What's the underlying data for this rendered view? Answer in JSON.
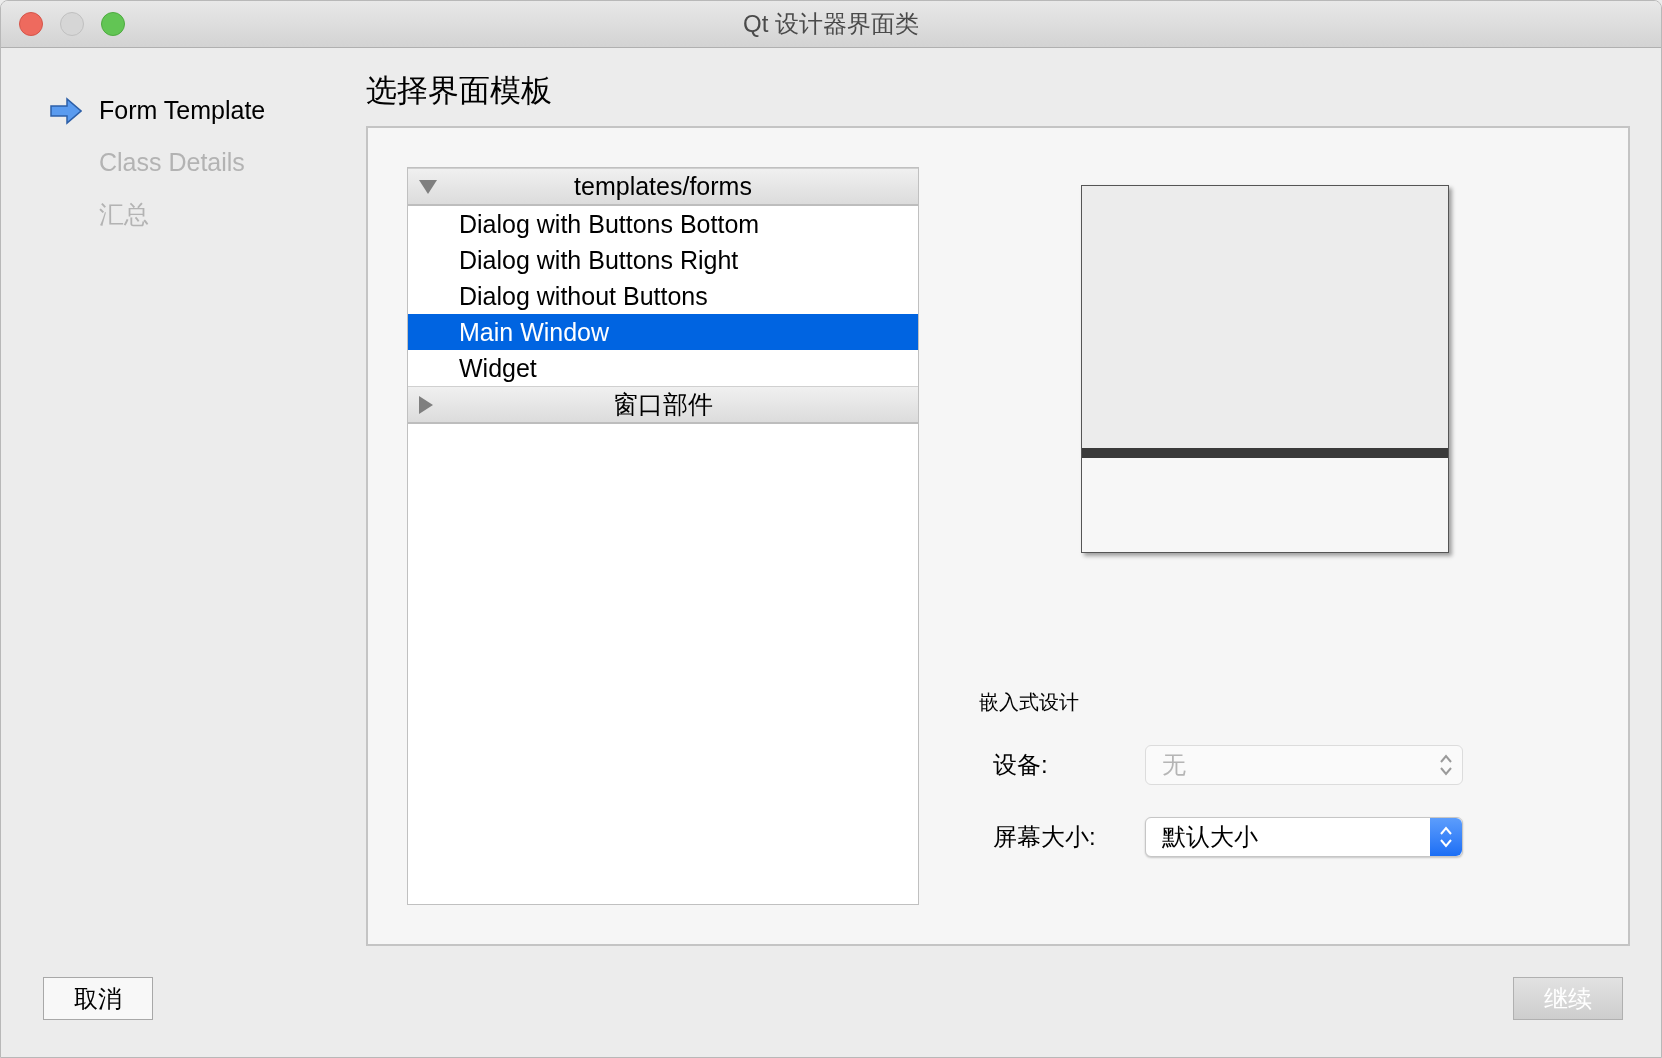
{
  "window": {
    "title": "Qt 设计器界面类"
  },
  "wizard_steps": [
    {
      "label": "Form Template",
      "current": true
    },
    {
      "label": "Class Details",
      "current": false
    },
    {
      "label": "汇总",
      "current": false
    }
  ],
  "heading": "选择界面模板",
  "template_tree": [
    {
      "label": "templates/forms",
      "expanded": true,
      "children": [
        {
          "label": "Dialog with Buttons Bottom",
          "selected": false
        },
        {
          "label": "Dialog with Buttons Right",
          "selected": false
        },
        {
          "label": "Dialog without Buttons",
          "selected": false
        },
        {
          "label": "Main Window",
          "selected": true
        },
        {
          "label": "Widget",
          "selected": false
        }
      ]
    },
    {
      "label": "窗口部件",
      "expanded": false
    }
  ],
  "embedded_design": {
    "title": "嵌入式设计",
    "fields": [
      {
        "label": "设备:",
        "value": "无",
        "disabled": true
      },
      {
        "label": "屏幕大小:",
        "value": "默认大小",
        "disabled": false
      }
    ]
  },
  "buttons": [
    {
      "label": "取消",
      "disabled": false
    },
    {
      "label": "继续",
      "disabled": true
    }
  ]
}
